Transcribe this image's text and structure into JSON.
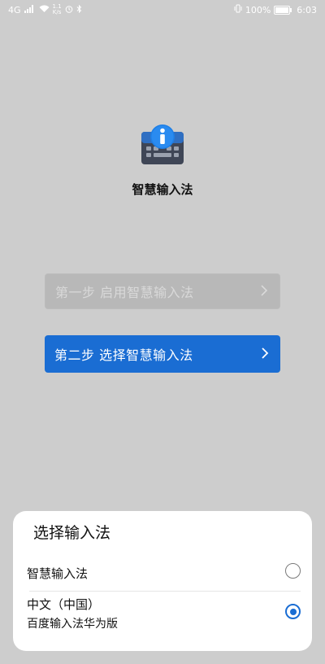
{
  "status_bar": {
    "left_text": "4G",
    "net_speed_top": "1.1",
    "net_speed_bottom": "K/s",
    "battery_percent": "100%",
    "time": "6:03"
  },
  "app": {
    "name": "智慧输入法",
    "icon": "keyboard-info-icon"
  },
  "steps": [
    {
      "label": "第一步 启用智慧输入法",
      "enabled": false
    },
    {
      "label": "第二步 选择智慧输入法",
      "enabled": true
    }
  ],
  "dialog": {
    "title": "选择输入法",
    "options": [
      {
        "label": "智慧输入法",
        "sub": "",
        "selected": false
      },
      {
        "label": "中文（中国）",
        "sub": "百度输入法华为版",
        "selected": true
      }
    ]
  },
  "colors": {
    "accent": "#1a6dd3",
    "background": "#cdcdcd"
  }
}
